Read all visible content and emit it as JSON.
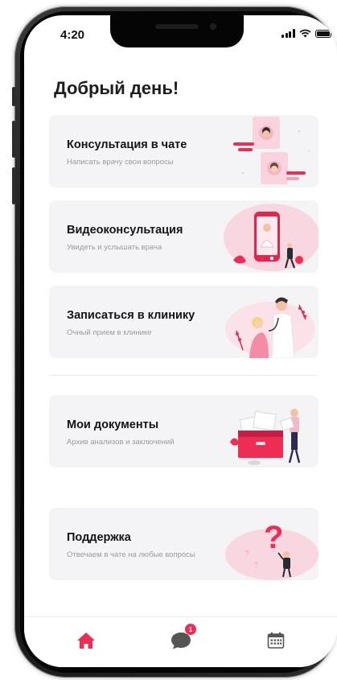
{
  "status_bar": {
    "time": "4:20"
  },
  "greeting": "Добрый день!",
  "cards": [
    {
      "title": "Консультация в чате",
      "subtitle": "Написать врачу свои вопросы"
    },
    {
      "title": "Видеоконсультация",
      "subtitle": "Увидеть и услышать врача"
    },
    {
      "title": "Записаться в клинику",
      "subtitle": "Очный прием в клинике"
    },
    {
      "title": "Мои документы",
      "subtitle": "Архив анализов и заключений"
    },
    {
      "title": "Поддержка",
      "subtitle": "Отвечаем в чате на любые вопросы"
    }
  ],
  "tabbar": {
    "items": [
      {
        "icon": "home-icon",
        "active": true
      },
      {
        "icon": "chat-icon",
        "badge": "1"
      },
      {
        "icon": "calendar-icon"
      }
    ]
  },
  "colors": {
    "accent": "#ee2d55",
    "card_bg": "#f4f4f6",
    "inactive_icon": "#555555",
    "illustration_pink": "#f7c9d4"
  }
}
